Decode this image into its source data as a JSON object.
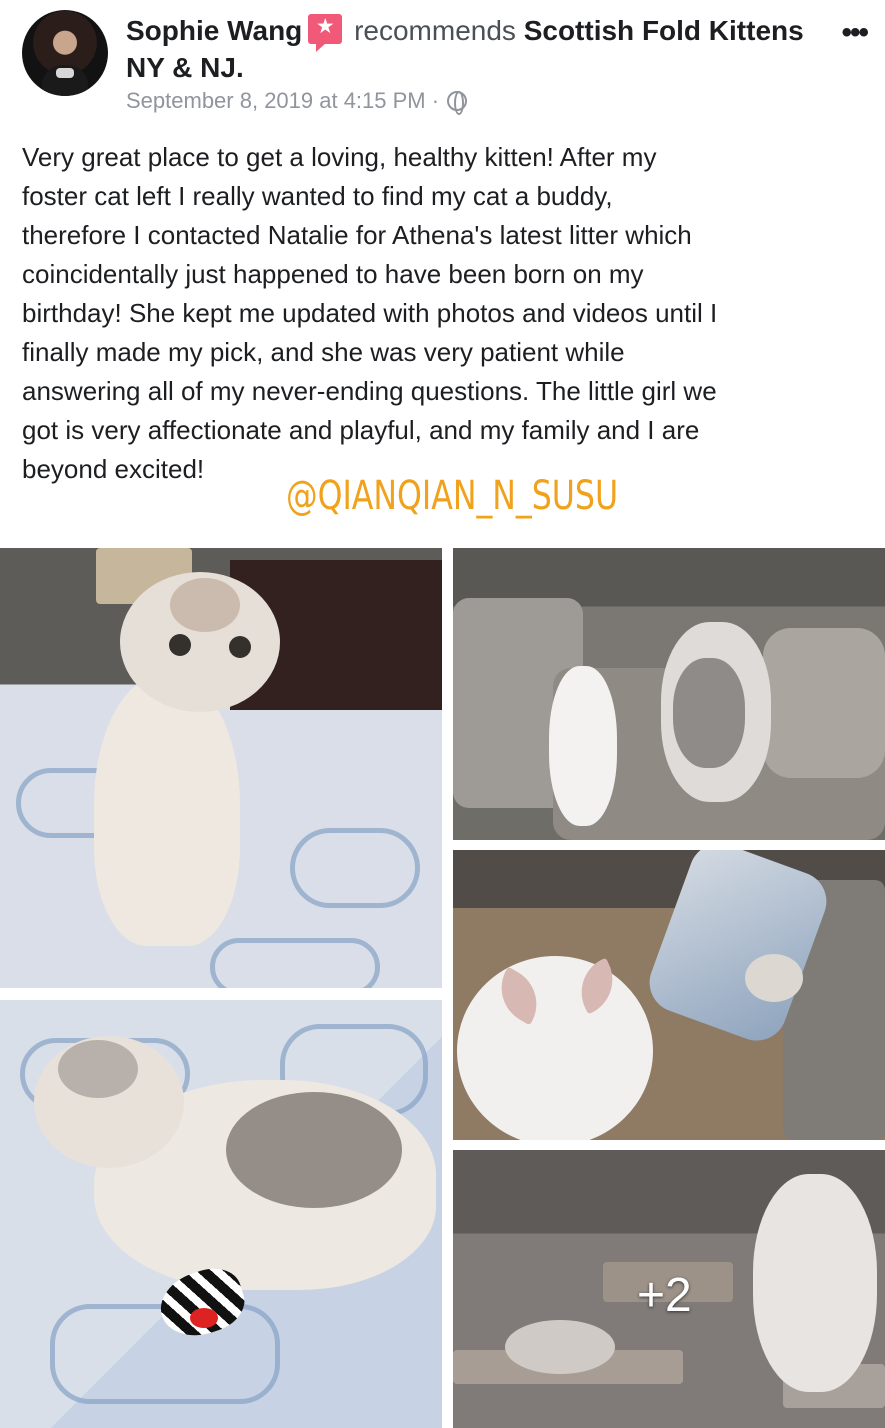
{
  "post": {
    "author": "Sophie Wang",
    "action": "recommends",
    "page": "Scottish Fold Kittens NY & NJ.",
    "timestamp": "September 8, 2019 at 4:15 PM · ",
    "more": "•••",
    "body": "Very great place to get a loving, healthy kitten! After my\nfoster cat left I really wanted to find my cat a buddy,\ntherefore I contacted Natalie for Athena's latest litter which\ncoincidentally just happened to have been born on my\nbirthday! She kept me updated with photos and videos until I\nfinally made my pick, and she was very patient while\nanswering all of my never-ending questions. The little girl we\ngot is very affectionate and playful, and my family and I are\nbeyond excited!"
  },
  "overlay": {
    "watermark": "@QIANQIAN_N_SUSU",
    "more_photos_count": "+2"
  },
  "icons": {
    "recommendation": "recommend-badge-icon",
    "privacy": "globe-icon",
    "menu": "more-options-icon"
  },
  "colors": {
    "text": "#1c1e21",
    "secondary_text": "#90949c",
    "recommend_badge": "#f05a78",
    "watermark": "#f0a21d"
  }
}
